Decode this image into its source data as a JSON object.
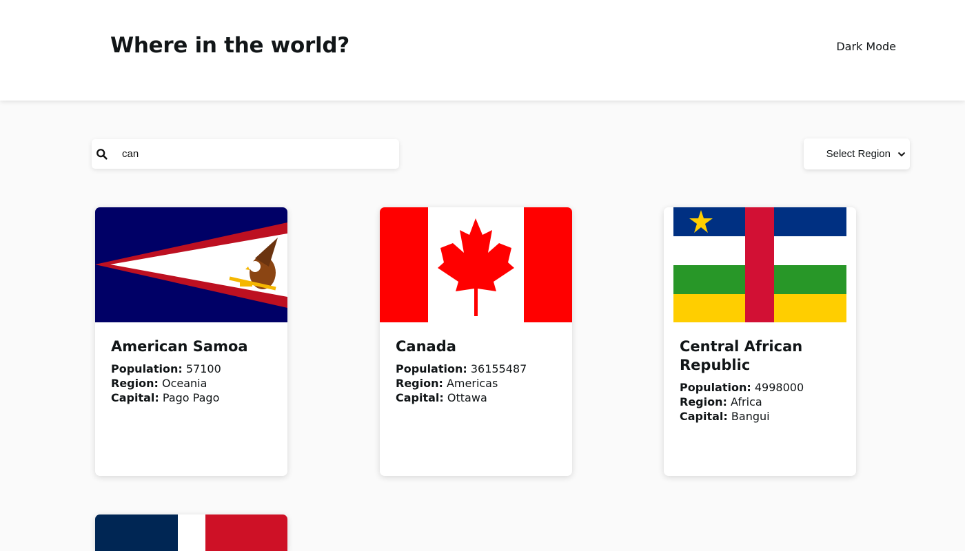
{
  "header": {
    "title": "Where in the world?",
    "dark_mode_label": "Dark Mode",
    "moon_icon": "moon-icon"
  },
  "search": {
    "value": "can",
    "icon": "search-icon"
  },
  "filter": {
    "selected": "Select Region"
  },
  "labels": {
    "population": "Population:",
    "region": "Region:",
    "capital": "Capital:"
  },
  "countries": [
    {
      "name": "American Samoa",
      "population": "57100",
      "region": "Oceania",
      "capital": "Pago Pago"
    },
    {
      "name": "Canada",
      "population": "36155487",
      "region": "Americas",
      "capital": "Ottawa"
    },
    {
      "name": "Central African Republic",
      "population": "4998000",
      "region": "Africa",
      "capital": "Bangui"
    }
  ]
}
